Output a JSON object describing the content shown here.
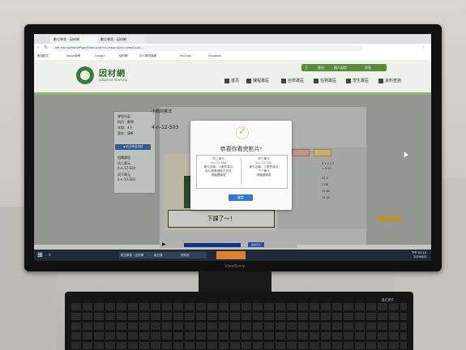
{
  "browser": {
    "tabs": [
      "數位學習 - 因材網",
      "數位學習 - 因材網"
    ],
    "url": "adl.edu.tw/HomePage/index.php?cs=lesson&ep=video&sid=...",
    "bookmarks": [
      "應用程式",
      "Yahoo奇摩",
      "Google",
      "因材網",
      "中小學資源網",
      "YouTube",
      "Facebook"
    ]
  },
  "site": {
    "logo_title": "因材網",
    "logo_subtitle": "adaptive learning",
    "user_bar": [
      "王",
      "登出",
      "個人設定",
      "訊息"
    ],
    "nav": [
      "首頁",
      "課程專區",
      "自學專區",
      "任務專區",
      "學生專區",
      "資料查詢"
    ]
  },
  "left_panel": {
    "lines": [
      "課程內容",
      "科目：數學",
      "年級：4下",
      "版本：康軒"
    ],
    "button": "◀ 前往學習測驗",
    "lines2": [
      "相關課程",
      "同上單元",
      "4-n-12-S04",
      "同下單元",
      "4-n-12-S02"
    ]
  },
  "lesson": {
    "title": "小數的乘法",
    "code": "4-n-12-S03"
  },
  "right_panel": {
    "tabs": [
      "筆記",
      "學習"
    ],
    "lines": [
      "4.1 x 1.2",
      "= 4.92",
      "11.4",
      "2.08",
      "11.80",
      "14.00"
    ]
  },
  "video": {
    "caption": "下課了～！"
  },
  "player": {
    "button": "播放影片"
  },
  "modal": {
    "title": "恭喜你看完影片!",
    "left_col": [
      "同上單元",
      "4-n-12-S04",
      "單元名稱：小數的乘法",
      "影片觀看進度已完成",
      "請繼續練習"
    ],
    "right_col": [
      "同下單元",
      "4-n-12-S02",
      "單元名稱：小數的乘法",
      "下一單元",
      "請繼續學習"
    ],
    "ok_button": "確定"
  },
  "taskbar": {
    "items": [
      "數位學習 - 因材網",
      "新分頁",
      "資料夾"
    ],
    "time": "下午 02:15",
    "date": "2019/6/3"
  },
  "monitor": {
    "brand": "ViewSonic"
  },
  "keyboard": {
    "brand": "acer"
  }
}
